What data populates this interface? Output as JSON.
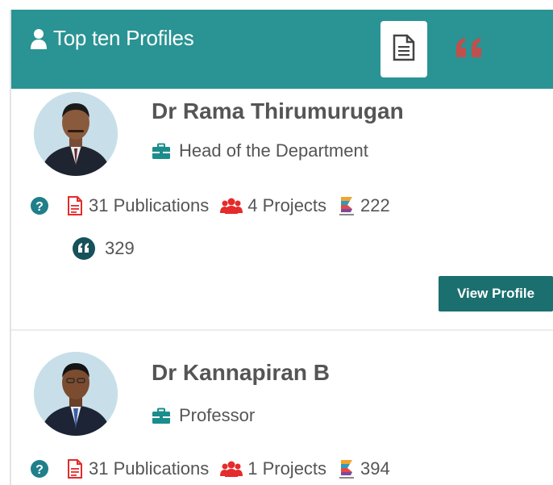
{
  "header": {
    "title": "Top ten Profiles"
  },
  "icons": {
    "user": "user-icon",
    "document_tab": "document-icon",
    "quote_tab": "quote-icon",
    "briefcase": "briefcase-icon",
    "help": "question-circle-icon",
    "publications": "file-pdf-icon",
    "projects": "users-icon",
    "metric": "stacked-bars-icon",
    "citations": "quote-circle-icon"
  },
  "colors": {
    "header_bg": "#2a9393",
    "button_bg": "#1b6f6f",
    "red": "#e52b2b",
    "teal": "#1b6f6f"
  },
  "profiles": [
    {
      "name": "Dr Rama Thirumurugan",
      "role": "Head of the Department",
      "publications": "31 Publications",
      "projects": "4 Projects",
      "metric": "222",
      "citations": "329",
      "button": "View Profile"
    },
    {
      "name": "Dr Kannapiran B",
      "role": "Professor",
      "publications": "31 Publications",
      "projects": "1 Projects",
      "metric": "394"
    }
  ]
}
